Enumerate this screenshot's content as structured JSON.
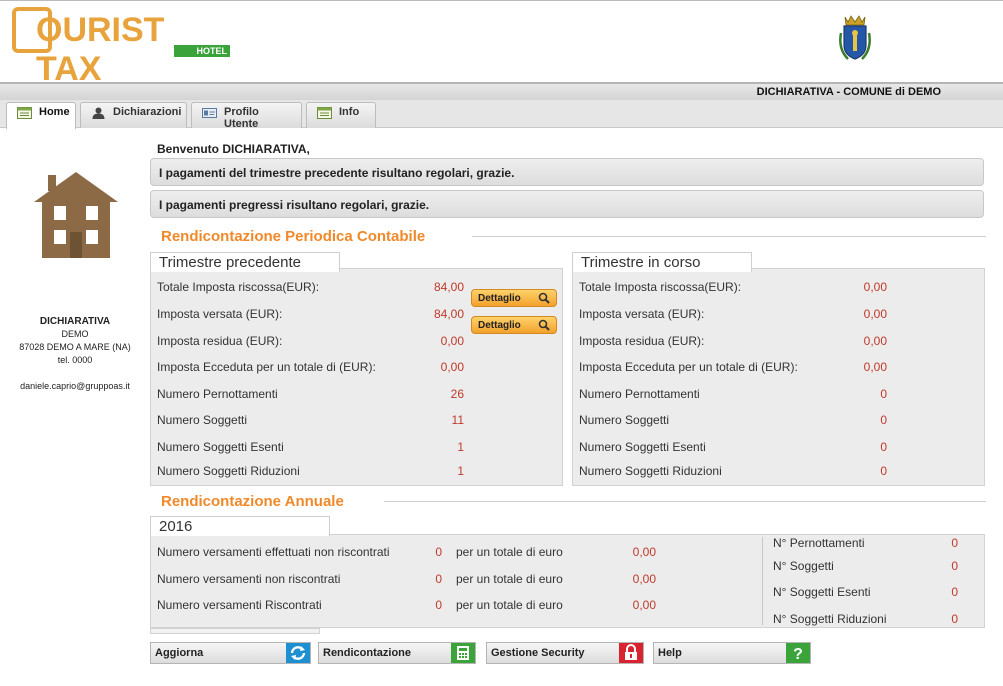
{
  "header": {
    "logo_text": "OURIST TAX",
    "logo_sub": "HOTEL",
    "title": "DICHIARATIVA - COMUNE di DEMO"
  },
  "tabs": [
    {
      "label": "Home",
      "icon": "home-icon"
    },
    {
      "label": "Dichiarazioni",
      "icon": "user-icon"
    },
    {
      "label": "Profilo Utente",
      "icon": "id-card-icon"
    },
    {
      "label": "Info",
      "icon": "info-icon"
    }
  ],
  "sidebar": {
    "name": "DICHIARATIVA",
    "line1": "DEMO",
    "line2": "87028 DEMO A MARE (NA)",
    "line3": "tel. 0000",
    "email": "daniele.caprio@gruppoas.it"
  },
  "main": {
    "welcome": "Benvenuto DICHIARATIVA,",
    "msg1": "I pagamenti del trimestre precedente risultano regolari, grazie.",
    "msg2": "I pagamenti pregressi risultano regolari, grazie.",
    "periodic_title": "Rendicontazione Periodica Contabile",
    "annual_title": "Rendicontazione Annuale",
    "detail_label": "Dettaglio"
  },
  "prev_quarter": {
    "title": "Trimestre precedente",
    "rows": [
      {
        "label": "Totale Imposta riscossa(EUR):",
        "value": "84,00"
      },
      {
        "label": "Imposta versata (EUR):",
        "value": "84,00"
      },
      {
        "label": "Imposta residua (EUR):",
        "value": "0,00"
      },
      {
        "label": "Imposta Ecceduta per un totale di (EUR):",
        "value": "0,00"
      },
      {
        "label": "Numero Pernottamenti",
        "value": "26"
      },
      {
        "label": "Numero Soggetti",
        "value": "11"
      },
      {
        "label": "Numero Soggetti Esenti",
        "value": "1"
      },
      {
        "label": "Numero Soggetti Riduzioni",
        "value": "1"
      }
    ]
  },
  "cur_quarter": {
    "title": "Trimestre in corso",
    "rows": [
      {
        "label": "Totale Imposta riscossa(EUR):",
        "value": "0,00"
      },
      {
        "label": "Imposta versata (EUR):",
        "value": "0,00"
      },
      {
        "label": "Imposta residua (EUR):",
        "value": "0,00"
      },
      {
        "label": "Imposta Ecceduta per un totale di (EUR):",
        "value": "0,00"
      },
      {
        "label": "Numero Pernottamenti",
        "value": "0"
      },
      {
        "label": "Numero Soggetti",
        "value": "0"
      },
      {
        "label": "Numero Soggetti Esenti",
        "value": "0"
      },
      {
        "label": "Numero Soggetti Riduzioni",
        "value": "0"
      }
    ]
  },
  "annual": {
    "year": "2016",
    "total_label": "per un totale di euro",
    "rows": [
      {
        "label": "Numero versamenti effettuati non riscontrati",
        "count": "0",
        "total": "0,00"
      },
      {
        "label": "Numero versamenti non riscontrati",
        "count": "0",
        "total": "0,00"
      },
      {
        "label": "Numero versamenti Riscontrati",
        "count": "0",
        "total": "0,00"
      }
    ],
    "stats": [
      {
        "label": "N° Pernottamenti",
        "value": "0"
      },
      {
        "label": "N° Soggetti",
        "value": "0"
      },
      {
        "label": "N° Soggetti Esenti",
        "value": "0"
      },
      {
        "label": "N° Soggetti Riduzioni",
        "value": "0"
      }
    ]
  },
  "buttons": [
    {
      "label": "Aggiorna",
      "icon": "refresh-icon",
      "color": "#1e8fd0"
    },
    {
      "label": "Rendicontazione",
      "icon": "calculator-icon",
      "color": "#3aa33a"
    },
    {
      "label": "Gestione Security",
      "icon": "lock-icon",
      "color": "#d9232e"
    },
    {
      "label": "Help",
      "icon": "help-icon",
      "color": "#3aa33a"
    }
  ],
  "colors": {
    "accent": "#f0892a",
    "value": "#c0392b",
    "house": "#8b6a45"
  }
}
